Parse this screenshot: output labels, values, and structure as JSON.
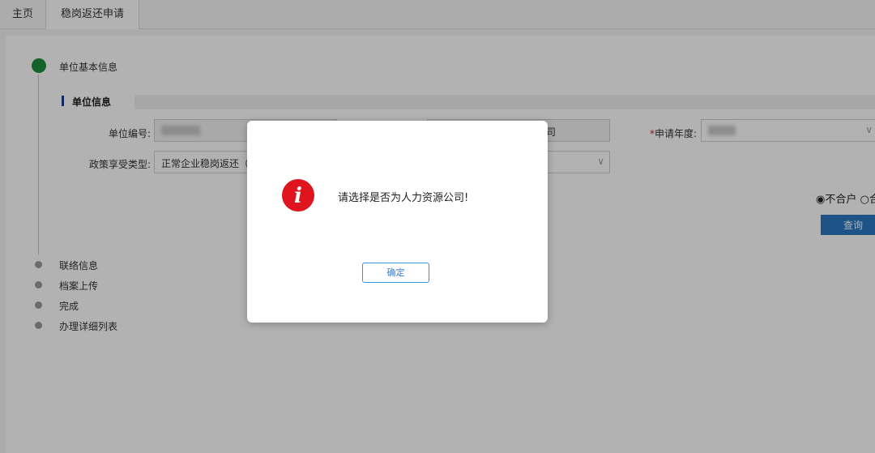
{
  "tabs": [
    {
      "label": "主页"
    },
    {
      "label": "稳岗返还申请",
      "active": true
    }
  ],
  "steps": [
    {
      "label": "单位基本信息",
      "status": "current"
    },
    {
      "label": "联络信息"
    },
    {
      "label": "档案上传"
    },
    {
      "label": "完成"
    },
    {
      "label": "办理详细列表"
    }
  ],
  "section": {
    "title": "单位信息"
  },
  "form": {
    "unit_code_label": "单位编号:",
    "unit_name_partial": "司",
    "apply_year_required_mark": "*",
    "apply_year_label": "申请年度:",
    "policy_type_label": "政策享受类型:",
    "policy_type_value": "正常企业稳岗返还（",
    "radio_not_merged": "不合户",
    "radio_merged_partial": "合"
  },
  "query_button": {
    "label": "查询"
  },
  "dialog": {
    "icon": "info-icon",
    "icon_glyph": "i",
    "message": "请选择是否为人力资源公司!",
    "ok_label": "确定"
  },
  "colors": {
    "step_active": "#1e8f3e",
    "query_button": "#2b78c2",
    "info_icon": "#e0141e",
    "ok_border": "#3a8ee6"
  }
}
